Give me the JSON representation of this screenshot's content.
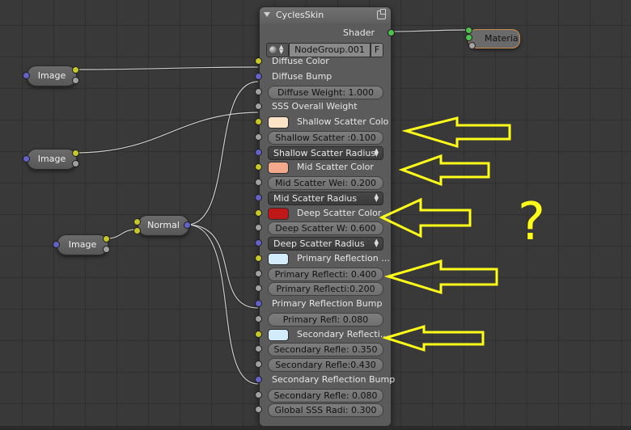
{
  "node": {
    "title": "CyclesSkin",
    "output_label": "Shader",
    "nodegroup_name": "NodeGroup.001",
    "fake_user_label": "F",
    "rows": [
      {
        "type": "socket-label",
        "label": "Diffuse Color",
        "socket": "yellow"
      },
      {
        "type": "socket-label",
        "label": "Diffuse Bump",
        "socket": "blue"
      },
      {
        "type": "field",
        "label": "Diffuse Weight:   1.000",
        "socket": "grey"
      },
      {
        "type": "socket-label",
        "label": "SSS Overall Weight",
        "socket": "grey"
      },
      {
        "type": "color",
        "label": "Shallow Scatter Colo",
        "socket": "yellow",
        "color": "#fde4c6"
      },
      {
        "type": "field",
        "label": "Shallow Scatter :0.100",
        "socket": "grey"
      },
      {
        "type": "dropdown",
        "label": "Shallow Scatter Radius",
        "socket": "blue"
      },
      {
        "type": "color",
        "label": "Mid Scatter Color",
        "socket": "yellow",
        "color": "#f2a98c"
      },
      {
        "type": "field",
        "label": "Mid Scatter Wei: 0.200",
        "socket": "grey"
      },
      {
        "type": "dropdown",
        "label": "Mid Scatter Radius",
        "socket": "blue"
      },
      {
        "type": "color",
        "label": "Deep Scatter Color",
        "socket": "yellow",
        "color": "#c01818"
      },
      {
        "type": "field",
        "label": "Deep Scatter W: 0.600",
        "socket": "grey"
      },
      {
        "type": "dropdown",
        "label": "Deep Scatter Radius",
        "socket": "blue"
      },
      {
        "type": "color",
        "label": "Primary Reflection ...",
        "socket": "yellow",
        "color": "#d2ecfb"
      },
      {
        "type": "field",
        "label": "Primary Reflecti: 0.400",
        "socket": "grey"
      },
      {
        "type": "field",
        "label": "Primary Reflecti:0.200",
        "socket": "grey"
      },
      {
        "type": "socket-label",
        "label": "Primary Reflection Bump",
        "socket": "blue"
      },
      {
        "type": "field",
        "label": "Primary Refl: 0.080",
        "socket": "grey"
      },
      {
        "type": "color",
        "label": "Secondary Reflecti...",
        "socket": "yellow",
        "color": "#d2ecfb"
      },
      {
        "type": "field",
        "label": "Secondary Refle: 0.350",
        "socket": "grey"
      },
      {
        "type": "field",
        "label": "Secondary Refle:0.430",
        "socket": "grey"
      },
      {
        "type": "socket-label",
        "label": "Secondary Reflection Bump",
        "socket": "blue"
      },
      {
        "type": "field",
        "label": "Secondary Refle: 0.080",
        "socket": "grey"
      },
      {
        "type": "field",
        "label": "Global SSS Radi: 0.300",
        "socket": "grey"
      }
    ]
  },
  "image_nodes": [
    {
      "label": "Image"
    },
    {
      "label": "Image"
    },
    {
      "label": "Image"
    }
  ],
  "normal_node": {
    "label": "Normal"
  },
  "material_node": {
    "label": "Materia"
  },
  "annotation": {
    "question_mark": "?"
  },
  "colors": {
    "annotation": "#ffff1a",
    "socket_yellow": "#c7c729",
    "socket_blue": "#6363c7",
    "socket_grey": "#a1a1a1",
    "socket_green": "#4ec14e"
  }
}
